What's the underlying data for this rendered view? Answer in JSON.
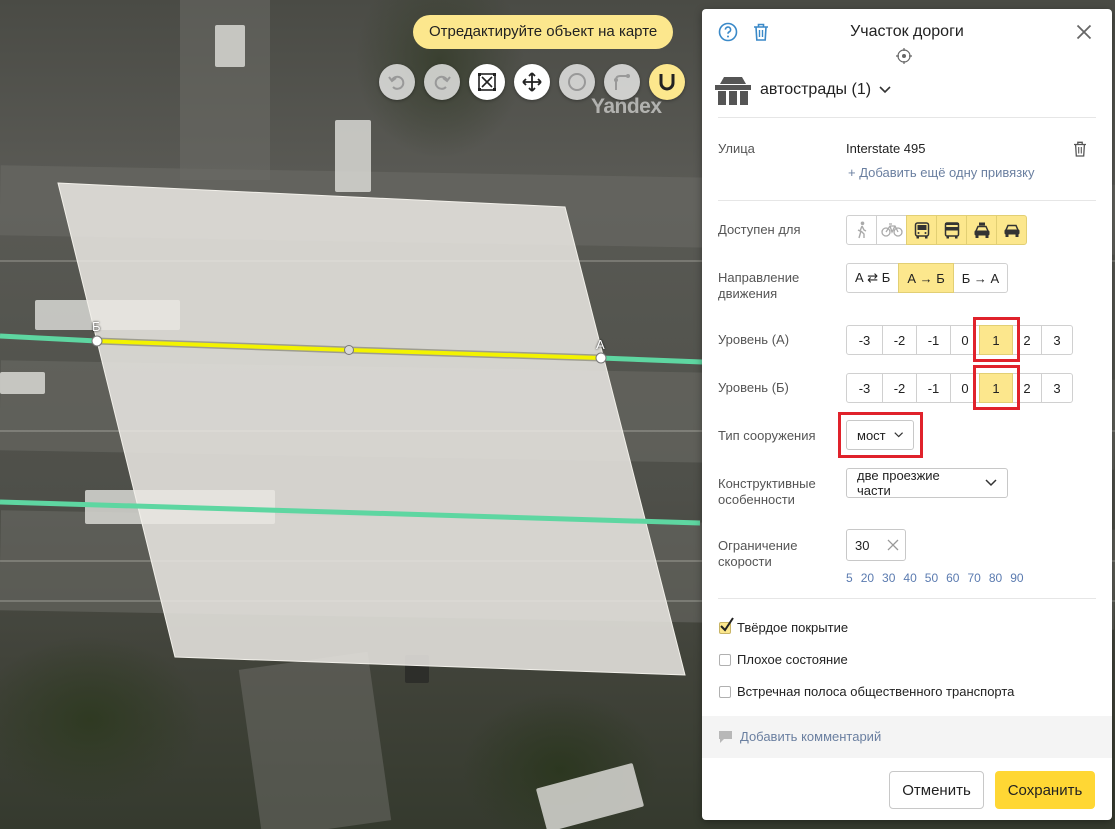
{
  "map": {
    "tooltip": "Отредактируйте объект на карте",
    "watermark": "Yandex",
    "point_start_label": "Б",
    "point_end_label": "А",
    "tools": [
      {
        "name": "undo-icon",
        "state": "disabled"
      },
      {
        "name": "redo-icon",
        "state": "disabled"
      },
      {
        "name": "bbox-edit-icon",
        "state": "enabled"
      },
      {
        "name": "move-icon",
        "state": "enabled"
      },
      {
        "name": "circle-icon",
        "state": "disabled"
      },
      {
        "name": "angle-icon",
        "state": "disabled"
      },
      {
        "name": "magnet-icon",
        "state": "active"
      }
    ],
    "colors": {
      "selected_road": "#f3f300",
      "road": "#5ed6a1",
      "bridge_fill": "#eae8e3"
    }
  },
  "panel": {
    "title": "Участок дороги",
    "road_type": "автострады (1)",
    "street": {
      "label": "Улица",
      "value": "Interstate 495",
      "add_link": "+ Добавить ещё одну привязку"
    },
    "access": {
      "label": "Доступен для",
      "options": [
        {
          "icon": "pedestrian-icon",
          "on": false
        },
        {
          "icon": "bicycle-icon",
          "on": false
        },
        {
          "icon": "bus-icon",
          "on": true
        },
        {
          "icon": "truck-icon",
          "on": true
        },
        {
          "icon": "taxi-icon",
          "on": true
        },
        {
          "icon": "car-icon",
          "on": true
        }
      ]
    },
    "direction": {
      "label": "Направление движения",
      "options": [
        "А ⇄ Б",
        "А → Б",
        "Б → А"
      ],
      "selected": 1
    },
    "level_a": {
      "label": "Уровень (А)",
      "options": [
        "-3",
        "-2",
        "-1",
        "0",
        "1",
        "2",
        "3"
      ],
      "selected": 4
    },
    "level_b": {
      "label": "Уровень (Б)",
      "options": [
        "-3",
        "-2",
        "-1",
        "0",
        "1",
        "2",
        "3"
      ],
      "selected": 4
    },
    "structure": {
      "label": "Тип сооружения",
      "value": "мост"
    },
    "construction": {
      "label": "Конструктивные особенности",
      "value": "две проезжие части"
    },
    "speed": {
      "label": "Ограничение скорости",
      "value": "30",
      "presets": [
        "5",
        "20",
        "30",
        "40",
        "50",
        "60",
        "70",
        "80",
        "90"
      ]
    },
    "checkboxes": [
      {
        "label": "Твёрдое покрытие",
        "checked": true
      },
      {
        "label": "Плохое состояние",
        "checked": false
      },
      {
        "label": "Встречная полоса общественного транспорта",
        "checked": false
      }
    ],
    "comment_link": "Добавить комментарий",
    "cancel_label": "Отменить",
    "save_label": "Сохранить"
  }
}
